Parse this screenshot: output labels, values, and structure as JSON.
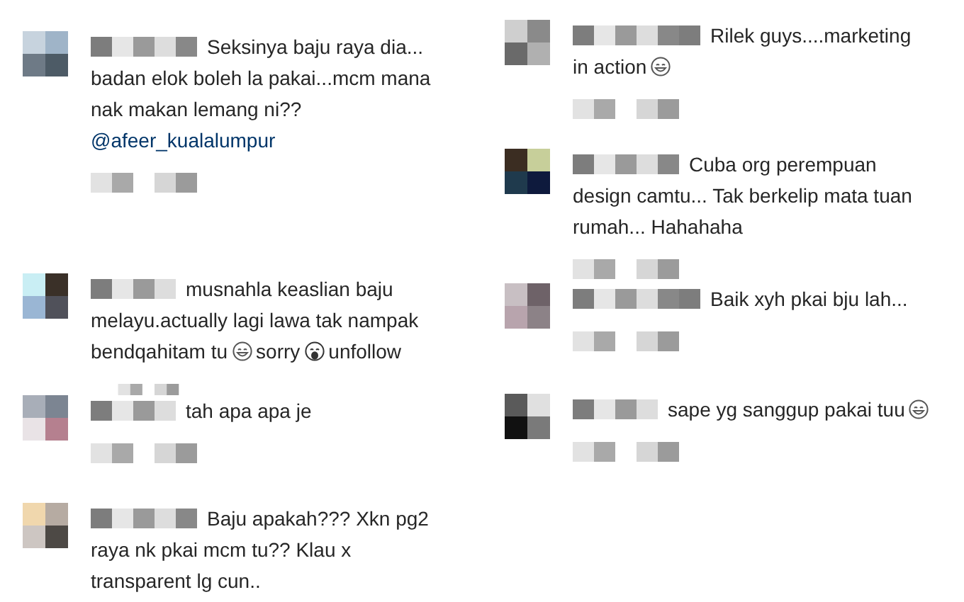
{
  "columns": [
    {
      "comments": [
        {
          "lines": [
            [
              {
                "kind": "text",
                "text": "Seksinya baju raya dia..."
              }
            ],
            [
              {
                "kind": "text",
                "text": "badan elok boleh la pakai...mcm mana"
              }
            ],
            [
              {
                "kind": "text",
                "text": "nak makan lemang ni??"
              }
            ],
            [
              {
                "kind": "link",
                "text": "@afeer_kualalumpur"
              }
            ]
          ]
        },
        {
          "lines": [
            [
              {
                "kind": "text",
                "text": "musnahla keaslian baju"
              }
            ],
            [
              {
                "kind": "text",
                "text": "melayu.actually lagi lawa tak nampak"
              }
            ],
            [
              {
                "kind": "text",
                "text": "bendqahitam tu"
              },
              {
                "kind": "grin"
              },
              {
                "kind": "text",
                "text": "sorry"
              },
              {
                "kind": "scream"
              },
              {
                "kind": "text",
                "text": "unfollow"
              }
            ]
          ]
        },
        {
          "lines": [
            [
              {
                "kind": "text",
                "text": "tah apa apa je"
              }
            ]
          ]
        },
        {
          "lines": [
            [
              {
                "kind": "text",
                "text": "Baju apakah??? Xkn pg2"
              }
            ],
            [
              {
                "kind": "text",
                "text": "raya nk pkai mcm tu?? Klau x"
              }
            ],
            [
              {
                "kind": "text",
                "text": "transparent lg cun.."
              }
            ]
          ]
        }
      ]
    },
    {
      "comments": [
        {
          "lines": [
            [
              {
                "kind": "text",
                "text": "Rilek guys....marketing"
              }
            ],
            [
              {
                "kind": "text",
                "text": "in action"
              },
              {
                "kind": "grin"
              }
            ]
          ]
        },
        {
          "lines": [
            [
              {
                "kind": "text",
                "text": "Cuba org perempuan"
              }
            ],
            [
              {
                "kind": "text",
                "text": "design camtu... Tak berkelip mata tuan"
              }
            ],
            [
              {
                "kind": "text",
                "text": "rumah... Hahahaha"
              }
            ]
          ]
        },
        {
          "lines": [
            [
              {
                "kind": "text",
                "text": "Baik xyh pkai bju lah..."
              }
            ]
          ]
        },
        {
          "lines": [
            [
              {
                "kind": "text",
                "text": "sape yg sanggup pakai tuu"
              },
              {
                "kind": "grin"
              }
            ]
          ]
        }
      ]
    }
  ]
}
